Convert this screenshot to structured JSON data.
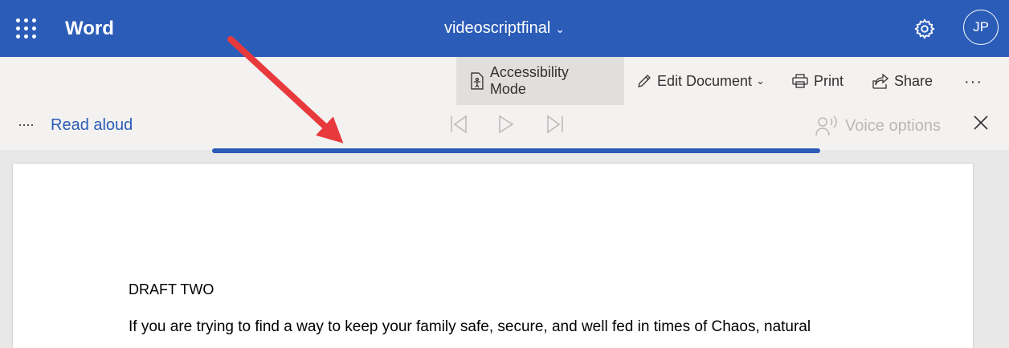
{
  "header": {
    "app_name": "Word",
    "doc_title": "videoscriptfinal",
    "avatar_initials": "JP",
    "brand_color": "#2b5cb8"
  },
  "ribbon": {
    "accessibility_mode": "Accessibility Mode",
    "edit_document": "Edit Document",
    "print": "Print",
    "share": "Share",
    "more": "···"
  },
  "read_aloud": {
    "menu": "····",
    "label": "Read aloud",
    "voice_options": "Voice options"
  },
  "document": {
    "heading": "DRAFT TWO",
    "paragraph": "If you are trying to find a way to keep your family safe, secure, and well fed in times of Chaos, natural"
  },
  "annotation": {
    "arrow_color": "#e8393d"
  }
}
